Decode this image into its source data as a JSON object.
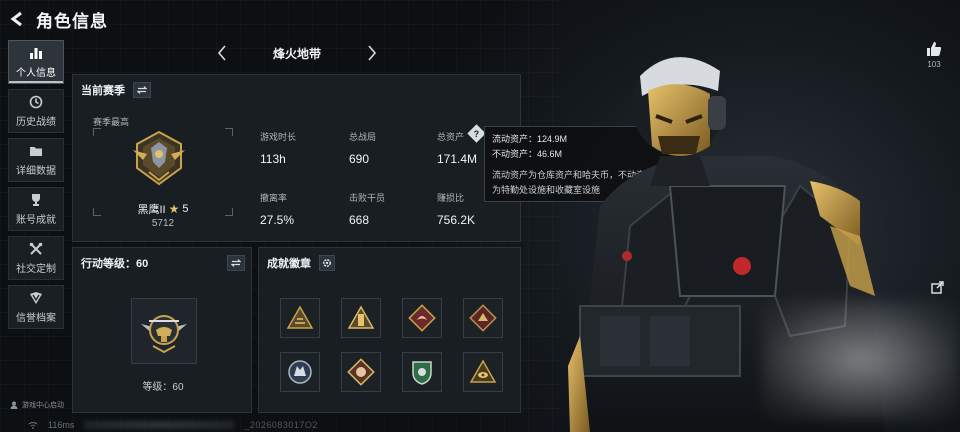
{
  "header": {
    "title": "角色信息"
  },
  "sidebar": {
    "items": [
      {
        "label": "个人信息",
        "icon": "bar-chart-icon",
        "active": true
      },
      {
        "label": "历史战绩",
        "icon": "history-icon"
      },
      {
        "label": "详细数据",
        "icon": "folder-icon"
      },
      {
        "label": "账号成就",
        "icon": "trophy-icon"
      },
      {
        "label": "社交定制",
        "icon": "tools-icon"
      },
      {
        "label": "信誉档案",
        "icon": "credit-icon"
      }
    ]
  },
  "footer": {
    "game_center_login": "游戏中心启动",
    "ping": "116ms",
    "user_id": "_2026083017O2"
  },
  "map_selector": {
    "name": "烽火地带"
  },
  "season": {
    "title": "当前赛季",
    "best_label": "赛季最高",
    "rank_name": "黑鹰II",
    "rank_stars": "5",
    "rank_score": "5712",
    "stats": [
      {
        "label": "游戏时长",
        "value": "113h"
      },
      {
        "label": "总战局",
        "value": "690"
      },
      {
        "label": "总资产",
        "value": "171.4M"
      },
      {
        "label": "撤离率",
        "value": "27.5%"
      },
      {
        "label": "击败干员",
        "value": "668"
      },
      {
        "label": "赚损比",
        "value": "756.2K"
      }
    ]
  },
  "tooltip": {
    "liquid": "流动资产：124.9M",
    "fixed": "不动资产：46.6M",
    "desc_line1": "流动资产为仓库资产和哈夫币，不动资产",
    "desc_line2": "为特勤处设施和收藏室设施"
  },
  "level": {
    "title": "行动等级：60",
    "label": "等级：60"
  },
  "achievements": {
    "title": "成就徽章",
    "badges": [
      "badge-1",
      "badge-2",
      "badge-3",
      "badge-4",
      "badge-5",
      "badge-6",
      "badge-7",
      "badge-8"
    ]
  },
  "likes": {
    "count": "103"
  },
  "colors": {
    "accent_gold": "#c9a24a",
    "panel_bg": "#1a1f24",
    "badge_green": "#2f6e45",
    "badge_red": "#8a2d2d"
  }
}
